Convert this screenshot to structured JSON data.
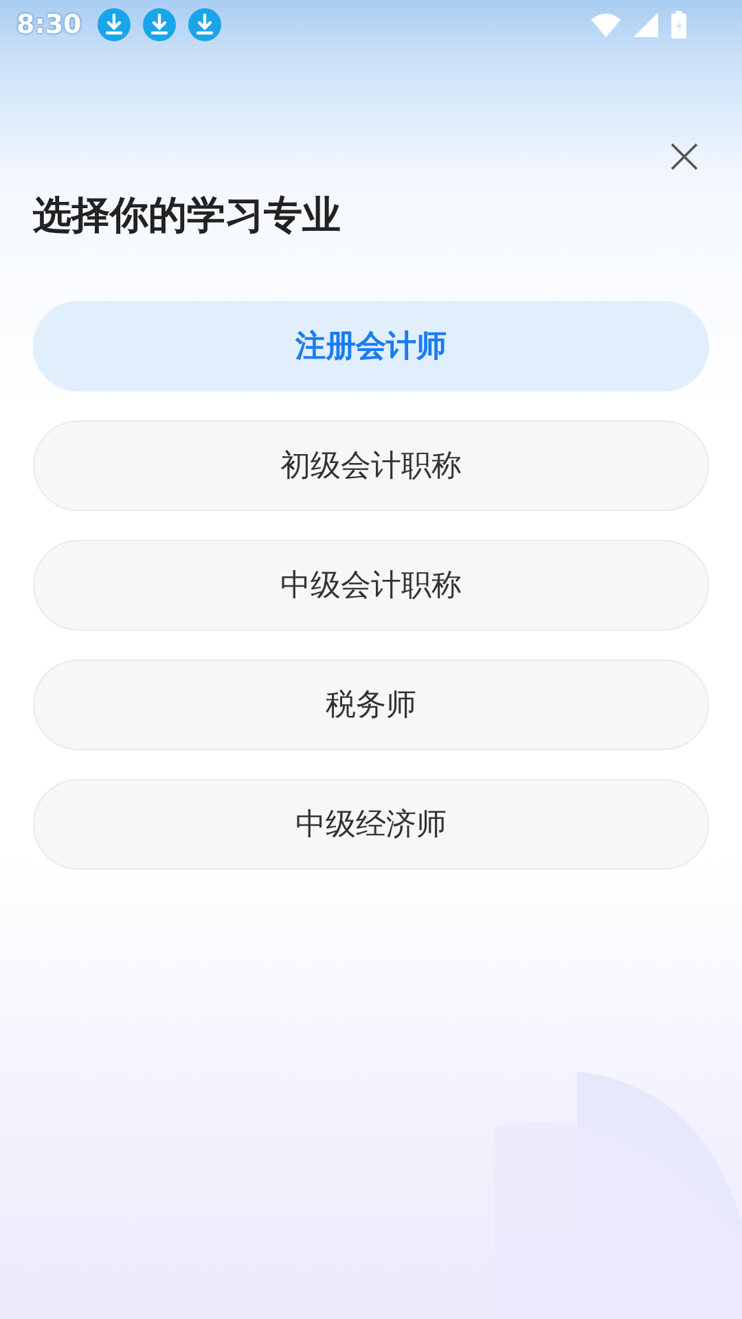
{
  "status_bar": {
    "time": "8:30",
    "notifications": [
      {
        "kind": "download"
      },
      {
        "kind": "download"
      },
      {
        "kind": "download"
      }
    ]
  },
  "title": "选择你的学习专业",
  "options": [
    {
      "label": "注册会计师",
      "selected": true
    },
    {
      "label": "初级会计职称",
      "selected": false
    },
    {
      "label": "中级会计职称",
      "selected": false
    },
    {
      "label": "税务师",
      "selected": false
    },
    {
      "label": "中级经济师",
      "selected": false
    }
  ]
}
